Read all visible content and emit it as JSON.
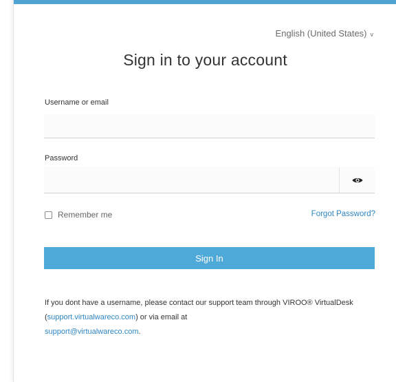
{
  "header": {
    "language": "English (United States)",
    "language_caret": "v"
  },
  "form": {
    "title": "Sign in to your account",
    "username_label": "Username or email",
    "username_value": "",
    "password_label": "Password",
    "password_value": "",
    "remember_label": "Remember me",
    "remember_checked": false,
    "forgot_link": "Forgot Password?",
    "submit_label": "Sign In"
  },
  "info": {
    "text_1": "If you dont have a username, please contact our support team through VIROO® VirtualDesk (",
    "link_1": "support.virtualwareco.com",
    "text_2": ") or via email at ",
    "link_2": "support@virtualwareco.com",
    "text_3": "."
  },
  "icons": {
    "password_toggle": "eye-icon",
    "language_dropdown": "chevron-down-icon"
  },
  "colors": {
    "accent": "#4ea9d9",
    "top_bar": "#4ea3d3",
    "link": "#2f86c1",
    "text": "#333333"
  }
}
